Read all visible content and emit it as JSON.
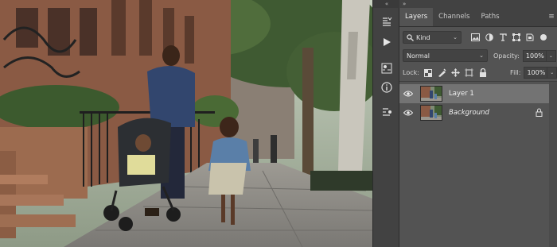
{
  "toolstrip": {
    "collapse_label": "«",
    "buttons": [
      "paragraph-icon",
      "play-icon",
      "properties-icon",
      "info-icon",
      "adjust-icon"
    ]
  },
  "panel": {
    "expand_label": "»",
    "menu_label": "≡",
    "tabs": [
      {
        "label": "Layers",
        "active": true
      },
      {
        "label": "Channels",
        "active": false
      },
      {
        "label": "Paths",
        "active": false
      }
    ],
    "filter": {
      "value": "Kind",
      "icons": [
        "image-filter-icon",
        "adjustment-filter-icon",
        "type-filter-icon",
        "shape-filter-icon",
        "smart-object-filter-icon",
        "filter-toggle-icon"
      ]
    },
    "blend_mode": "Normal",
    "opacity_label": "Opacity:",
    "opacity_value": "100%",
    "lock_label": "Lock:",
    "fill_label": "Fill:",
    "fill_value": "100%",
    "layers": [
      {
        "name": "Layer 1",
        "visible": true,
        "selected": true,
        "locked": false
      },
      {
        "name": "Background",
        "visible": true,
        "selected": false,
        "locked": true
      }
    ]
  },
  "colors": {
    "panel_bg": "#535353",
    "panel_dark": "#424242",
    "selected_layer": "#737373",
    "text": "#dcdcdc"
  }
}
